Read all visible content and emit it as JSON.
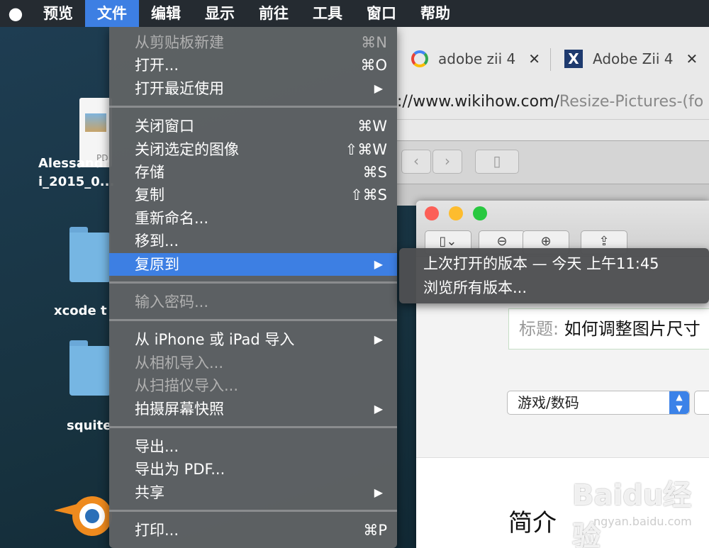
{
  "menubar": {
    "items": [
      "预览",
      "文件",
      "编辑",
      "显示",
      "前往",
      "工具",
      "窗口",
      "帮助"
    ],
    "active_index": 1
  },
  "desktop": {
    "icons": [
      {
        "label1": "Alessandr",
        "label2": "i_2015_0...",
        "tag": "PD"
      },
      {
        "label": "xcode t"
      },
      {
        "label": "squite"
      }
    ]
  },
  "browser": {
    "tabs": [
      {
        "title": "adobe zii 4"
      },
      {
        "title": "Adobe Zii 4"
      }
    ],
    "url_prefix": "://www.wikihow.com/",
    "url_path": "Resize-Pictures-(fo"
  },
  "preview_window": {
    "title_label": "标题:",
    "title_value": "如何调整图片尺寸",
    "category": "游戏/数码",
    "heading": "简介"
  },
  "watermark": {
    "text": "Baidu经验",
    "sub": "ngyan.baidu.com"
  },
  "file_menu": {
    "groups": [
      [
        {
          "label": "从剪贴板新建",
          "shortcut": "⌘N",
          "disabled": true
        },
        {
          "label": "打开...",
          "shortcut": "⌘O"
        },
        {
          "label": "打开最近使用",
          "submenu": true
        }
      ],
      [
        {
          "label": "关闭窗口",
          "shortcut": "⌘W"
        },
        {
          "label": "关闭选定的图像",
          "shortcut": "⇧⌘W"
        },
        {
          "label": "存储",
          "shortcut": "⌘S"
        },
        {
          "label": "复制",
          "shortcut": "⇧⌘S"
        },
        {
          "label": "重新命名..."
        },
        {
          "label": "移到..."
        },
        {
          "label": "复原到",
          "submenu": true,
          "highlighted": true
        }
      ],
      [
        {
          "label": "输入密码...",
          "disabled": true
        }
      ],
      [
        {
          "label": "从 iPhone 或 iPad 导入",
          "submenu": true
        },
        {
          "label": "从相机导入...",
          "disabled": true
        },
        {
          "label": "从扫描仪导入...",
          "disabled": true
        },
        {
          "label": "拍摄屏幕快照",
          "submenu": true
        }
      ],
      [
        {
          "label": "导出..."
        },
        {
          "label": "导出为 PDF..."
        },
        {
          "label": "共享",
          "submenu": true
        }
      ],
      [
        {
          "label": "打印...",
          "shortcut": "⌘P"
        }
      ]
    ]
  },
  "revert_submenu": {
    "items": [
      "上次打开的版本 — 今天 上午11:45",
      "浏览所有版本..."
    ]
  },
  "icons": {
    "apple": "apple-icon",
    "submenu_arrow": "▶"
  }
}
